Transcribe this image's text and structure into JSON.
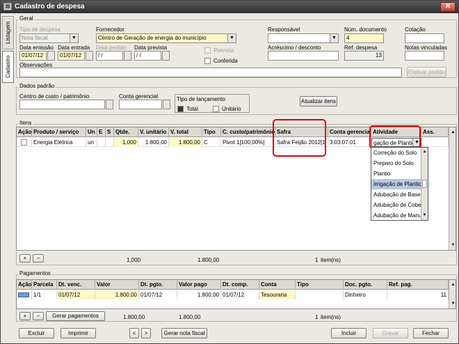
{
  "window": {
    "title": "Cadastro de despesa",
    "close": "✕"
  },
  "side_tabs": {
    "listagem": "Listagem",
    "cadastro": "Cadastro"
  },
  "geral": {
    "title": "Geral",
    "tipo_despesa": {
      "label": "Tipo de despesa",
      "value": "Nota fiscal"
    },
    "fornecedor": {
      "label": "Fornecedor",
      "value": "Centro de Geração de energia do município"
    },
    "responsavel": {
      "label": "Responsável",
      "value": ""
    },
    "num_documento": {
      "label": "Núm. documento",
      "value": "4"
    },
    "cotacao": {
      "label": "Cotação",
      "value": ""
    },
    "data_emissao": {
      "label": "Data emissão",
      "value": "01/07/12"
    },
    "data_entrada": {
      "label": "Data entrada",
      "value": "01/07/12"
    },
    "data_pedido": {
      "label": "Data pedido",
      "value": " /  / "
    },
    "data_prevista": {
      "label": "Data prevista",
      "value": " /  / "
    },
    "prevista": "Prevista",
    "conferida": "Conferida",
    "acrescimo": {
      "label": "Acréscimo / desconto",
      "value": ""
    },
    "ref_despesa": {
      "label": "Ref. despesa",
      "value": "13"
    },
    "notas_vinculadas": {
      "label": "Notas vinculadas",
      "value": ""
    },
    "observacoes": {
      "label": "Observações",
      "value": ""
    },
    "efetivar_pedido": "Efetivar pedido"
  },
  "dados_padrao": {
    "title": "Dados padrão",
    "centro_custo": "Centro de custo / patrimônio",
    "conta_gerencial": "Conta gerencial",
    "tipo_lancamento": "Tipo de lançamento",
    "total": "Total",
    "unitario": "Unitário",
    "atualizar_itens": "Atualizar itens"
  },
  "itens": {
    "title": "Itens",
    "columns": [
      "Ação",
      "Produto / serviço",
      "Un",
      "E",
      "S",
      "Qtde.",
      "V. unitário",
      "V. total",
      "Tipo",
      "C. custo/patrimônio",
      "Safra",
      "Conta gerencial",
      "Atividade",
      "Ass."
    ],
    "row": {
      "produto": "Energia Elétrica",
      "un": "un",
      "qtde": "1,000",
      "v_unitario": "1.800,00",
      "v_total": "1.800,00",
      "tipo": "C",
      "c_custo": "Pivot 1[100,00%]",
      "safra": "Safra  Feijão  2012[1",
      "conta_gerencial": "3.03.07.01",
      "atividade": "gação de Plantio"
    },
    "atividade_options": [
      "Correção do Solo",
      "Preparo do Solo",
      "Plantio",
      "Irrigação de Plantio",
      "Adubação de Base",
      "Adubação de Cober",
      "Adubação de Manu"
    ],
    "atividade_selected": 3,
    "footer": {
      "qtde": "1,000",
      "v_total": "1.800,00",
      "count": "1",
      "count_label": "item(ns)"
    },
    "add": "+",
    "remove": "−"
  },
  "pagamentos": {
    "title": "Pagamentos",
    "columns": [
      "Ação",
      "Parcela",
      "Dt. venc.",
      "Valor",
      "Dt. pgto.",
      "Valor pago",
      "Dt. comp.",
      "Conta",
      "Tipo",
      "Doc. pgto.",
      "Ref. pag."
    ],
    "row": {
      "parcela": "1/1",
      "dt_venc": "01/07/12",
      "valor": "1.800,00",
      "dt_pgto": "01/07/12",
      "valor_pago": "1.800,00",
      "dt_comp": "01/07/12",
      "conta": "Tesouraria",
      "tipo": "",
      "doc_pgto": "Dinheiro",
      "ref_pag": "11"
    },
    "footer": {
      "valor": "1.800,00",
      "valor_pago": "1.800,00",
      "count": "1",
      "count_label": "item(ns)"
    },
    "gerar_pagamentos": "Gerar pagamentos",
    "add": "+",
    "remove": "−"
  },
  "bottom": {
    "excluir": "Excluir",
    "imprimir": "Imprimir",
    "prev": "<",
    "next": ">",
    "gerar_nota_fiscal": "Gerar nota fiscal",
    "incluir": "Incluir",
    "gravar": "Gravar",
    "fechar": "Fechar"
  }
}
